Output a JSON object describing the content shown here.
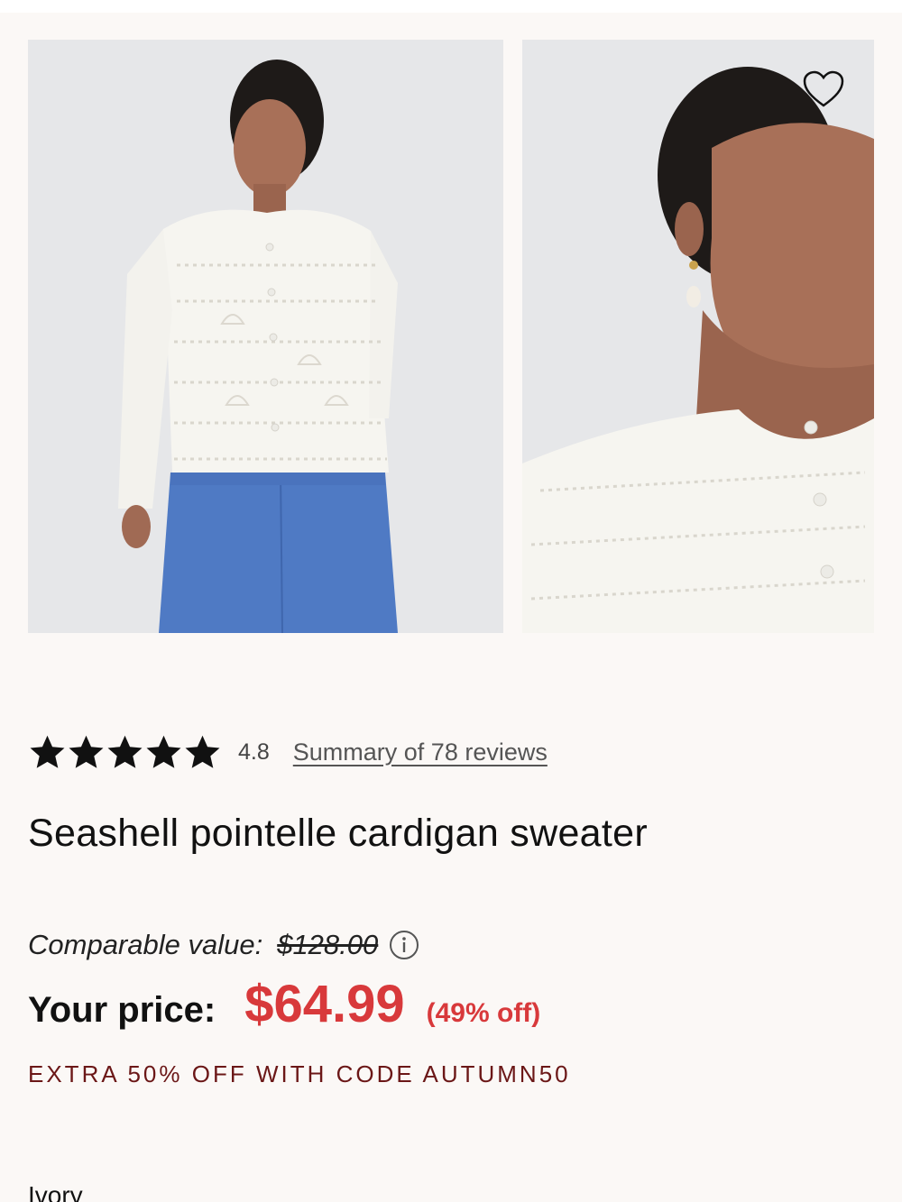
{
  "gallery": {
    "images": [
      {
        "alt": "Model wearing ivory seashell pointelle cardigan with blue trousers"
      },
      {
        "alt": "Close-up of ivory seashell pointelle cardigan neckline"
      }
    ],
    "wishlist_icon": "heart-outline-icon"
  },
  "rating": {
    "stars": 5,
    "value": "4.8",
    "reviews_link": "Summary of 78 reviews"
  },
  "product": {
    "title": "Seashell pointelle cardigan sweater"
  },
  "pricing": {
    "comparable_label": "Comparable value:",
    "comparable_value": "$128.00",
    "info_icon": "info-circle-icon",
    "your_price_label": "Your price:",
    "your_price_value": "$64.99",
    "discount": "(49% off)",
    "promo": "EXTRA 50% OFF WITH CODE AUTUMN50"
  },
  "selected_color": "Ivory",
  "colors": {
    "background": "#fbf8f6",
    "price_red": "#d8393b",
    "promo_maroon": "#6b1717"
  }
}
